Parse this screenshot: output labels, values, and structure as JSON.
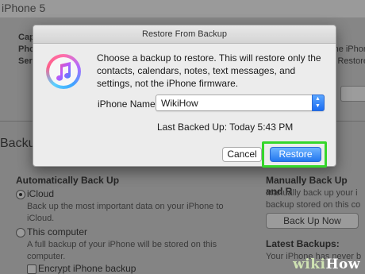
{
  "background": {
    "top_title": "iPhone 5",
    "summary_labels": [
      "Cap",
      "Pho",
      "Seri"
    ],
    "right_fragments": [
      "f the iPhon",
      "lick Restore"
    ],
    "backups_title": "Backu",
    "auto_backup": {
      "heading": "Automatically Back Up",
      "icloud_label": "iCloud",
      "icloud_desc": "Back up the most important data on your iPhone to iCloud.",
      "computer_label": "This computer",
      "computer_desc": "A full backup of your iPhone will be stored on this computer.",
      "encrypt_label": "Encrypt iPhone backup"
    },
    "manual_backup": {
      "heading": "Manually Back Up and R",
      "desc": "Manually back up your i backup stored on this co",
      "back_up_now": "Back Up Now",
      "latest_heading": "Latest Backups:",
      "latest_desc": "Your iPhone has never b"
    },
    "watermark_a": "wiki",
    "watermark_b": "How"
  },
  "dialog": {
    "title": "Restore From Backup",
    "message": "Choose a backup to restore. This will restore only the contacts, calendars, notes, text messages, and settings, not the iPhone firmware.",
    "name_label": "iPhone Name:",
    "selected_backup": "WikiHow",
    "last_backed_up": "Last Backed Up: Today 5:43 PM",
    "cancel_label": "Cancel",
    "restore_label": "Restore",
    "app_icon": "itunes-icon",
    "highlight_color": "#35d62b"
  }
}
